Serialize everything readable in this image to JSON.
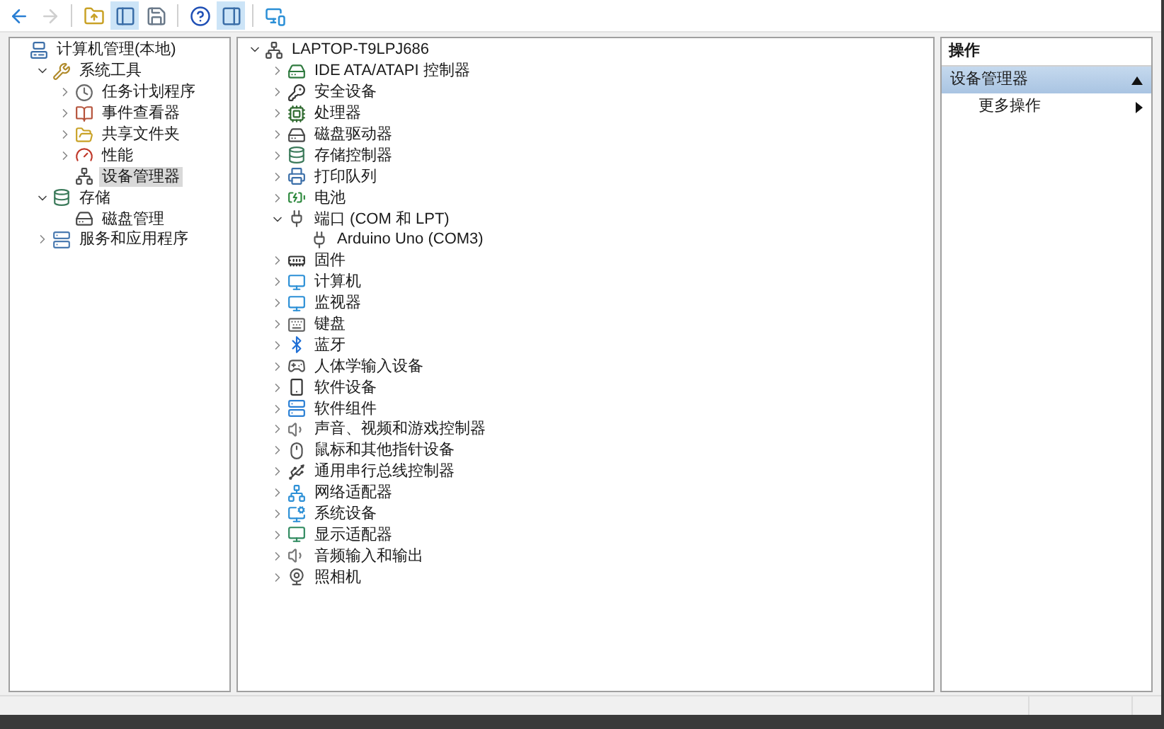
{
  "toolbar": [
    {
      "pressed": false,
      "disabled": false
    },
    {
      "pressed": false,
      "disabled": true
    },
    {
      "pressed": false,
      "disabled": false
    },
    {
      "pressed": true,
      "disabled": false
    },
    {
      "pressed": false,
      "disabled": false
    },
    {
      "pressed": false,
      "disabled": false
    },
    {
      "pressed": true,
      "disabled": false
    },
    {
      "pressed": false,
      "disabled": false
    }
  ],
  "console_tree": [
    {
      "label": "计算机管理(本地)",
      "selected": false,
      "children": [
        {
          "label": "系统工具",
          "expanded": true,
          "selected": false,
          "children": [
            {
              "label": "任务计划程序",
              "expanded": false,
              "selected": false
            },
            {
              "label": "事件查看器",
              "expanded": false,
              "selected": false
            },
            {
              "label": "共享文件夹",
              "expanded": false,
              "selected": false
            },
            {
              "label": "性能",
              "expanded": false,
              "selected": false
            },
            {
              "label": "设备管理器",
              "selected": true
            }
          ]
        },
        {
          "label": "存储",
          "expanded": true,
          "selected": false,
          "children": [
            {
              "label": "磁盘管理",
              "selected": false
            }
          ]
        },
        {
          "label": "服务和应用程序",
          "expanded": false,
          "selected": false
        }
      ]
    }
  ],
  "device_tree": [
    {
      "label": "LAPTOP-T9LPJ686",
      "expanded": true,
      "children": [
        {
          "label": "IDE ATA/ATAPI 控制器",
          "expanded": false
        },
        {
          "label": "安全设备",
          "expanded": false
        },
        {
          "label": "处理器",
          "expanded": false
        },
        {
          "label": "磁盘驱动器",
          "expanded": false
        },
        {
          "label": "存储控制器",
          "expanded": false
        },
        {
          "label": "打印队列",
          "expanded": false
        },
        {
          "label": "电池",
          "expanded": false
        },
        {
          "label": "端口 (COM 和 LPT)",
          "expanded": true,
          "children": [
            {
              "label": "Arduino Uno (COM3)"
            }
          ]
        },
        {
          "label": "固件",
          "expanded": false
        },
        {
          "label": "计算机",
          "expanded": false
        },
        {
          "label": "监视器",
          "expanded": false
        },
        {
          "label": "键盘",
          "expanded": false
        },
        {
          "label": "蓝牙",
          "expanded": false
        },
        {
          "label": "人体学输入设备",
          "expanded": false
        },
        {
          "label": "软件设备",
          "expanded": false
        },
        {
          "label": "软件组件",
          "expanded": false
        },
        {
          "label": "声音、视频和游戏控制器",
          "expanded": false
        },
        {
          "label": "鼠标和其他指针设备",
          "expanded": false
        },
        {
          "label": "通用串行总线控制器",
          "expanded": false
        },
        {
          "label": "网络适配器",
          "expanded": false
        },
        {
          "label": "系统设备",
          "expanded": false
        },
        {
          "label": "显示适配器",
          "expanded": false
        },
        {
          "label": "音频输入和输出",
          "expanded": false
        },
        {
          "label": "照相机",
          "expanded": false
        }
      ]
    }
  ],
  "actions": {
    "title": "操作",
    "sections": [
      {
        "title": "设备管理器",
        "expanded": true,
        "items": [
          {
            "label": "更多操作"
          }
        ]
      }
    ]
  }
}
